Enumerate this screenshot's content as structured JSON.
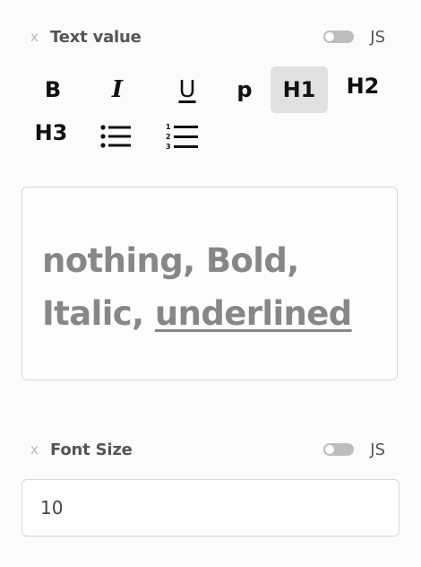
{
  "text_value": {
    "clear_label": "x",
    "label": "Text value",
    "js_toggle_on": false,
    "js_label": "JS"
  },
  "toolbar": {
    "bold": "B",
    "italic": "I",
    "underline": "U",
    "paragraph": "p",
    "h1": "H1",
    "h2": "H2",
    "h3": "H3",
    "active_button": "H1",
    "bullet_list_icon": "bullet-list-icon",
    "numbered_list_icon": "numbered-list-icon"
  },
  "editor": {
    "segment_plain": "nothing, Bold,",
    "segment_italic": "Italic, ",
    "segment_underlined": "underlined",
    "text_color": "#878787"
  },
  "font_size": {
    "clear_label": "x",
    "label": "Font Size",
    "js_toggle_on": false,
    "js_label": "JS",
    "value": "10"
  },
  "colors": {
    "background": "#fbfbfb",
    "active_button": "#e1e1e1",
    "toggle_off": "#bdbdbd",
    "border": "#d6d6d6"
  }
}
